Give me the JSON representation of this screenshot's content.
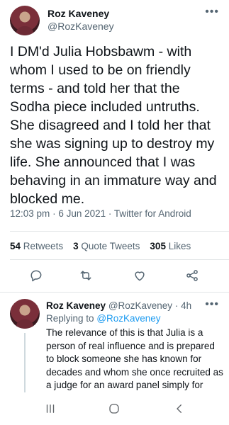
{
  "tweet": {
    "author_name": "Roz Kaveney",
    "author_handle": "@RozKaveney",
    "more_glyph": "•••",
    "text": "I DM'd Julia Hobsbawm - with whom I used to be on friendly terms - and told her that the Sodha piece included untruths. She disagreed and I told her that she was signing up to destroy my life. She announced that I was behaving in an immature way and blocked me.",
    "time": "12:03 pm",
    "date": "6 Jun 2021",
    "source": "Twitter for Android",
    "separator": "·"
  },
  "stats": {
    "retweets_count": "54",
    "retweets_label": "Retweets",
    "quotes_count": "3",
    "quotes_label": "Quote Tweets",
    "likes_count": "305",
    "likes_label": "Likes"
  },
  "actions": [
    {
      "icon": "reply-icon"
    },
    {
      "icon": "retweet-icon"
    },
    {
      "icon": "like-icon"
    },
    {
      "icon": "share-icon"
    }
  ],
  "reply": {
    "author_name": "Roz Kaveney",
    "author_handle": "@RozKaveney",
    "separator": "·",
    "age": "4h",
    "more_glyph": "•••",
    "replying_prefix": "Replying to",
    "replying_handle": "@RozKaveney",
    "text": "The relevance of this is that Julia is a person of real influence and is prepared to block someone she has known for decades and whom she once recruited as a judge for an award panel simply for saying that the attack on Stonewall is untrue."
  },
  "navbar": [
    {
      "icon": "recent-apps-icon"
    },
    {
      "icon": "home-icon"
    },
    {
      "icon": "back-icon"
    }
  ],
  "colors": {
    "link": "#1d9bf0",
    "secondary_text": "#536471",
    "primary_text": "#0f1419"
  }
}
